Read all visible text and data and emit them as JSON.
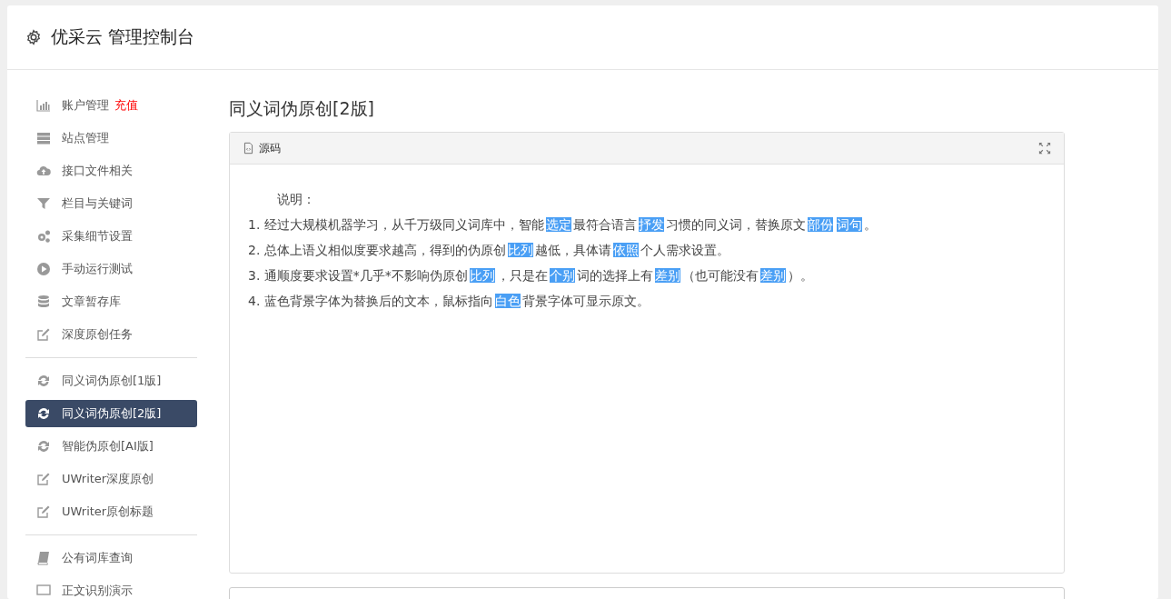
{
  "header": {
    "title": "优采云 管理控制台"
  },
  "sidebar": {
    "groups": [
      {
        "items": [
          {
            "kind": "chart",
            "label": "账户管理",
            "badge": "充值",
            "selected": false
          },
          {
            "kind": "server",
            "label": "站点管理",
            "selected": false
          },
          {
            "kind": "cloud",
            "label": "接口文件相关",
            "selected": false
          },
          {
            "kind": "filter",
            "label": "栏目与关键词",
            "selected": false
          },
          {
            "kind": "gears",
            "label": "采集细节设置",
            "selected": false
          },
          {
            "kind": "play",
            "label": "手动运行测试",
            "selected": false
          },
          {
            "kind": "database",
            "label": "文章暂存库",
            "selected": false
          },
          {
            "kind": "edit",
            "label": "深度原创任务",
            "selected": false
          }
        ]
      },
      {
        "items": [
          {
            "kind": "refresh",
            "label": "同义词伪原创[1版]",
            "selected": false
          },
          {
            "kind": "refresh",
            "label": "同义词伪原创[2版]",
            "selected": true
          },
          {
            "kind": "refresh",
            "label": "智能伪原创[AI版]",
            "selected": false
          },
          {
            "kind": "edit",
            "label": "UWriter深度原创",
            "selected": false
          },
          {
            "kind": "edit",
            "label": "UWriter原创标题",
            "selected": false
          }
        ]
      },
      {
        "items": [
          {
            "kind": "book",
            "label": "公有词库查询",
            "selected": false
          },
          {
            "kind": "monitor",
            "label": "正文识别演示",
            "selected": false
          }
        ]
      }
    ]
  },
  "page_title": "同义词伪原创[2版]",
  "editor": {
    "toolbar_label": "源码",
    "heading": "说明：",
    "lines": [
      [
        {
          "text": "1. 经过大规模机器学习，从千万级同义词库中，智能",
          "highlighted": false
        },
        {
          "text": "选定",
          "highlighted": true
        },
        {
          "text": "最符合语言",
          "highlighted": false
        },
        {
          "text": "抒发",
          "highlighted": true
        },
        {
          "text": "习惯的同义词，替换原文",
          "highlighted": false
        },
        {
          "text": "部份",
          "highlighted": true
        },
        {
          "text": "词句",
          "highlighted": true
        },
        {
          "text": "。",
          "highlighted": false
        }
      ],
      [
        {
          "text": "2. 总体上语义相似度要求越高，得到的伪原创",
          "highlighted": false
        },
        {
          "text": "比列",
          "highlighted": true
        },
        {
          "text": "越低，具体请",
          "highlighted": false
        },
        {
          "text": "依照",
          "highlighted": true
        },
        {
          "text": "个人需求设置。",
          "highlighted": false
        }
      ],
      [
        {
          "text": "3. 通顺度要求设置*几乎*不影响伪原创",
          "highlighted": false
        },
        {
          "text": "比列",
          "highlighted": true
        },
        {
          "text": "，只是在",
          "highlighted": false
        },
        {
          "text": "个别",
          "highlighted": true
        },
        {
          "text": "词的选择上有",
          "highlighted": false
        },
        {
          "text": "差别",
          "highlighted": true
        },
        {
          "text": "（也可能没有",
          "highlighted": false
        },
        {
          "text": "差别",
          "highlighted": true
        },
        {
          "text": "）。",
          "highlighted": false
        }
      ],
      [
        {
          "text": "4. 蓝色背景字体为替换后的文本，鼠标指向",
          "highlighted": false
        },
        {
          "text": "白色",
          "highlighted": true
        },
        {
          "text": "背景字体可显示原文。",
          "highlighted": false
        }
      ]
    ]
  }
}
